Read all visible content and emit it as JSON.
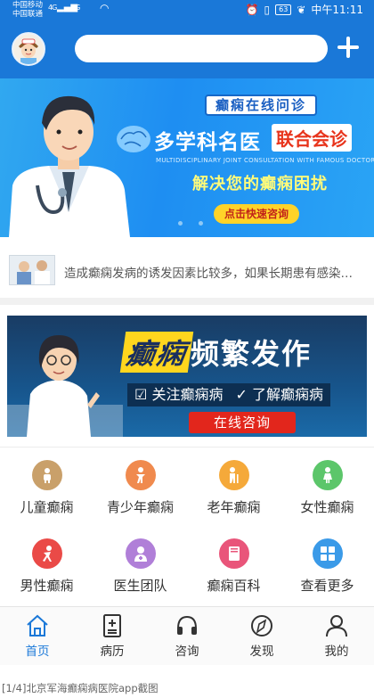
{
  "status_bar": {
    "carrier_1": "中国移动",
    "carrier_2": "中国联通",
    "signal_1": "4G",
    "signal_2": "3G",
    "battery": "63",
    "time": "中午11:11"
  },
  "header": {
    "search_placeholder": ""
  },
  "banner_main": {
    "tag": "癫痫在线问诊",
    "title_part1": "多学科名医",
    "title_part2": "联合会诊",
    "english": "MULTIDISCIPLINARY JOINT CONSULTATION WITH FAMOUS DOCTORS",
    "subtitle": "解决您的癫痫困扰",
    "button": "点击快速咨询"
  },
  "news": {
    "text": "造成癫痫发病的诱发因素比较多，如果长期患有感染…"
  },
  "banner_second": {
    "title_highlight": "癫痫",
    "title_rest": "频繁发作",
    "check_1": "关注癫痫病",
    "check_2": "了解癫痫病",
    "button": "在线咨询"
  },
  "grid": {
    "items": [
      {
        "label": "儿童癫痫",
        "icon": "child-icon",
        "color": "#c9a06a"
      },
      {
        "label": "青少年癫痫",
        "icon": "teen-icon",
        "color": "#f08a4e"
      },
      {
        "label": "老年癫痫",
        "icon": "elderly-icon",
        "color": "#f5a93a"
      },
      {
        "label": "女性癫痫",
        "icon": "female-icon",
        "color": "#5cc66a"
      },
      {
        "label": "男性癫痫",
        "icon": "male-icon",
        "color": "#ea4a47"
      },
      {
        "label": "医生团队",
        "icon": "doctor-icon",
        "color": "#b07fd8"
      },
      {
        "label": "癫痫百科",
        "icon": "book-icon",
        "color": "#e9557a"
      },
      {
        "label": "查看更多",
        "icon": "grid-more-icon",
        "color": "#3a9ae8"
      }
    ]
  },
  "tabbar": {
    "tabs": [
      {
        "label": "首页",
        "icon": "home-icon",
        "active": true
      },
      {
        "label": "病历",
        "icon": "medical-record-icon",
        "active": false
      },
      {
        "label": "咨询",
        "icon": "headset-icon",
        "active": false
      },
      {
        "label": "发现",
        "icon": "compass-icon",
        "active": false
      },
      {
        "label": "我的",
        "icon": "user-icon",
        "active": false
      }
    ],
    "accent": "#1a78d8"
  },
  "caption": "[1/4]北京军海癫痫病医院app截图"
}
